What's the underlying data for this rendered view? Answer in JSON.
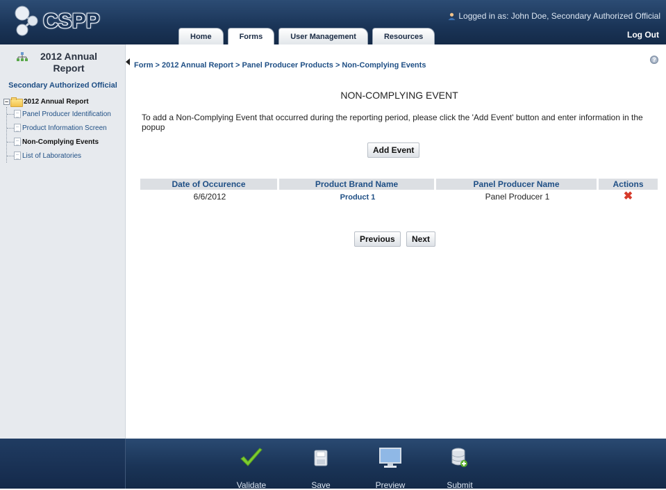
{
  "app": {
    "name": "CSPP"
  },
  "header": {
    "login_text": "Logged in as: John Doe, Secondary Authorized Official",
    "logout_label": "Log Out",
    "tabs": [
      {
        "label": "Home"
      },
      {
        "label": "Forms",
        "active": true
      },
      {
        "label": "User Management"
      },
      {
        "label": "Resources"
      }
    ]
  },
  "sidebar": {
    "title": "2012 Annual Report",
    "role": "Secondary Authorized Official",
    "tree": {
      "root_label": "2012 Annual Report",
      "items": [
        {
          "label": "Panel Producer Identification"
        },
        {
          "label": "Product Information Screen"
        },
        {
          "label": "Non-Complying Events",
          "active": true
        },
        {
          "label": "List of Laboratories"
        }
      ]
    }
  },
  "main": {
    "breadcrumb": "Form > 2012 Annual Report > Panel Producer Products > Non-Complying Events",
    "title": "NON-COMPLYING EVENT",
    "instructions": "To add a Non-Complying Event that occurred during the reporting period, please click the 'Add Event' button and enter information in the popup",
    "add_event_label": "Add Event",
    "table": {
      "columns": [
        "Date of Occurence",
        "Product Brand Name",
        "Panel Producer Name",
        "Actions"
      ],
      "rows": [
        {
          "date": "6/6/2012",
          "product": "Product 1",
          "producer": "Panel Producer 1"
        }
      ]
    },
    "previous_label": "Previous",
    "next_label": "Next"
  },
  "footer": {
    "tools": [
      {
        "label": "Validate",
        "icon": "checkmark-icon"
      },
      {
        "label": "Save",
        "icon": "save-icon"
      },
      {
        "label": "Preview",
        "icon": "monitor-icon"
      },
      {
        "label": "Submit",
        "icon": "database-icon"
      }
    ]
  },
  "colors": {
    "header_bg": "#1a3457",
    "link": "#1f4f85",
    "delete": "#d63a2a",
    "check": "#6fbf2a"
  }
}
